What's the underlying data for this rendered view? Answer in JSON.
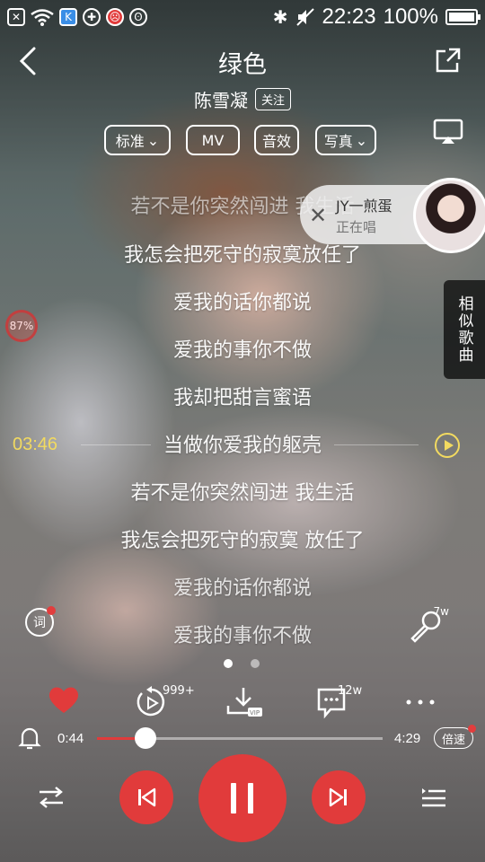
{
  "status_bar": {
    "time": "22:23",
    "battery": "100%",
    "battery_level": 1.0
  },
  "header": {
    "title": "绿色",
    "artist": "陈雪凝",
    "follow_label": "关注"
  },
  "pills": [
    {
      "label": "标准",
      "has_dropdown": true
    },
    {
      "label": "MV",
      "has_dropdown": false
    },
    {
      "label": "音效",
      "has_dropdown": false
    },
    {
      "label": "写真",
      "has_dropdown": true
    }
  ],
  "floating_singer": {
    "name": "JY一煎蛋",
    "status": "正在唱"
  },
  "similar_songs_label": "相似歌曲",
  "mini_badge": "87%",
  "lyrics": [
    {
      "text": "若不是你突然闯进 我生活",
      "style": "dim"
    },
    {
      "text": "我怎会把死守的寂寞放任了",
      "style": "normal"
    },
    {
      "text": "爱我的话你都说",
      "style": "normal"
    },
    {
      "text": "爱我的事你不做",
      "style": "normal"
    },
    {
      "text": "我却把甜言蜜语",
      "style": "normal"
    },
    {
      "text": "当做你爱我的躯壳",
      "style": "normal"
    },
    {
      "text": "若不是你突然闯进 我生活",
      "style": "normal"
    },
    {
      "text": "我怎会把死守的寂寞 放任了",
      "style": "normal"
    },
    {
      "text": "爱我的话你都说",
      "style": "faded"
    },
    {
      "text": "爱我的事你不做",
      "style": "faded"
    }
  ],
  "seek_time": "03:46",
  "lyric_button_label": "词",
  "mic_count": "7w",
  "actions": {
    "replay_count": "999+",
    "comment_count": "12w"
  },
  "progress": {
    "current": "0:44",
    "duration": "4:29",
    "fraction": 0.17,
    "speed_label": "倍速"
  },
  "colors": {
    "accent": "#e13b3b",
    "seek_highlight": "#f2da60"
  },
  "page_indicator": {
    "count": 2,
    "active": 0
  }
}
